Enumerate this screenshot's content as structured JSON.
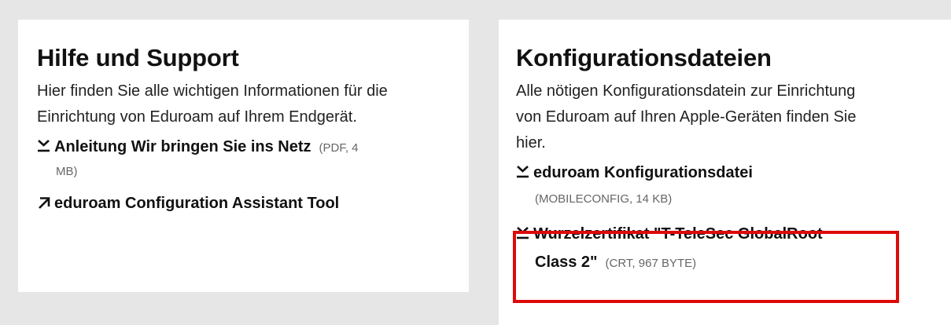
{
  "left": {
    "title": "Hilfe und Support",
    "description": "Hier finden Sie alle wichtigen Informationen für die Einrichtung von Eduroam auf Ihrem Endgerät.",
    "links": [
      {
        "icon": "download-icon",
        "label": "Anleitung Wir bringen Sie ins Netz",
        "meta_a": "(PDF, 4",
        "meta_b": "MB)"
      },
      {
        "icon": "external-link-icon",
        "label": "eduroam Configuration Assistant Tool"
      }
    ]
  },
  "right": {
    "title": "Konfigurationsdateien",
    "description": "Alle nötigen Konfigurationsdatein zur Einrichtung von Eduroam auf Ihren Apple-Geräten finden Sie hier.",
    "links": [
      {
        "icon": "download-icon",
        "label": "eduroam Konfigurationsdatei",
        "meta": "(MOBILECONFIG, 14 KB)"
      },
      {
        "icon": "download-icon",
        "label_a": "Wurzelzertifikat \"T-TeleSec GlobalRoot",
        "label_b": "Class 2\"",
        "meta": "(CRT, 967 BYTE)"
      }
    ]
  },
  "colors": {
    "highlight": "#dd0a0a",
    "background": "#e6e6e6",
    "card": "#ffffff"
  }
}
